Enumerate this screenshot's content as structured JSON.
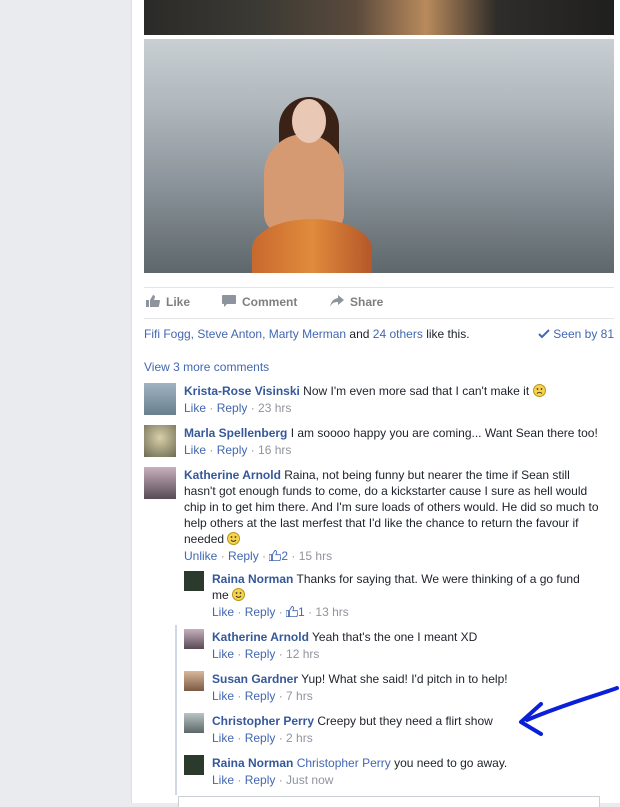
{
  "actions": {
    "like": "Like",
    "comment": "Comment",
    "share": "Share"
  },
  "likes": {
    "names": "Fifi Fogg, Steve Anton, Marty Merman",
    "and": "and",
    "others": "24 others",
    "suffix": "like this."
  },
  "seen": "Seen by 81",
  "view_more": "View 3 more comments",
  "comments": [
    {
      "name": "Krista-Rose Visinski",
      "text": "Now I'm even more sad that I can't make it",
      "like": "Like",
      "reply": "Reply",
      "time": "23 hrs"
    },
    {
      "name": "Marla Spellenberg",
      "text": "I am soooo happy you are coming... Want Sean there too!",
      "like": "Like",
      "reply": "Reply",
      "time": "16 hrs"
    },
    {
      "name": "Katherine Arnold",
      "text": "Raina, not being funny but nearer the time if Sean still hasn't got enough funds to come, do a kickstarter cause I sure as hell would chip in to get him there. And I'm sure loads of others would. He did so much to help others at the last merfest that I'd like the chance to return the favour if needed",
      "like": "Unlike",
      "reply": "Reply",
      "likes_count": "2",
      "time": "15 hrs"
    }
  ],
  "replies": [
    {
      "name": "Raina Norman",
      "text": "Thanks for saying that. We were thinking of a go fund me",
      "like": "Like",
      "reply": "Reply",
      "likes_count": "1",
      "time": "13 hrs"
    },
    {
      "name": "Katherine Arnold",
      "text": "Yeah that's the one I meant XD",
      "like": "Like",
      "reply": "Reply",
      "time": "12 hrs"
    },
    {
      "name": "Susan Gardner",
      "text": "Yup! What she said! I'd pitch in to help!",
      "like": "Like",
      "reply": "Reply",
      "time": "7 hrs"
    },
    {
      "name": "Christopher Perry",
      "text": "Creepy but they need a flirt show",
      "like": "Like",
      "reply": "Reply",
      "time": "2 hrs"
    },
    {
      "name": "Raina Norman",
      "mention": "Christopher Perry",
      "text": "you need to go away.",
      "like": "Like",
      "reply": "Reply",
      "time": "Just now"
    }
  ],
  "colors": {
    "link": "#365899",
    "meta": "#90949c",
    "annotation": "#0a1fd8"
  },
  "icons": {
    "like": "thumbs-up-icon",
    "comment": "speech-bubble-icon",
    "share": "share-arrow-icon",
    "seen": "checkmark-icon",
    "smiley": "smiley-emoji-icon",
    "annotation": "blue-arrow-annotation"
  }
}
